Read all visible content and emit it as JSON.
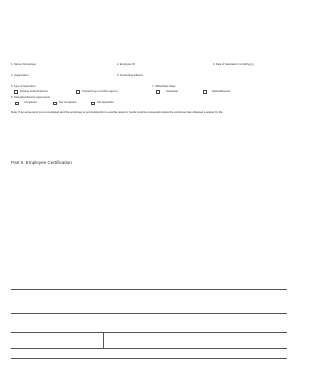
{
  "fields": {
    "row1": [
      "1. Name of Employee",
      "2. Employee ID",
      "3. Date of Separation (mm/dd/yyyy)"
    ],
    "row2": [
      "4. Organization",
      "5. Forwarding Address"
    ],
    "type_label": "6. Type of Separation",
    "type_options": [
      "Existing Federal Service",
      "Transferring to Another Agency"
    ],
    "other_label": "7. Office/State Stays",
    "other_options": [
      "Separated",
      "Retired/Expired"
    ],
    "agreements_label": "8. Relocation/Service Agreements",
    "agreement_options": [
      "Completed",
      "Not Completed",
      "Not Applicable"
    ]
  },
  "note": "Note: If an agreement is not completed and the employee is not transferring to another agency, funds must be recovered unless the employee has obtained a waiver by the",
  "part_title": "Part II. Employee Certification"
}
